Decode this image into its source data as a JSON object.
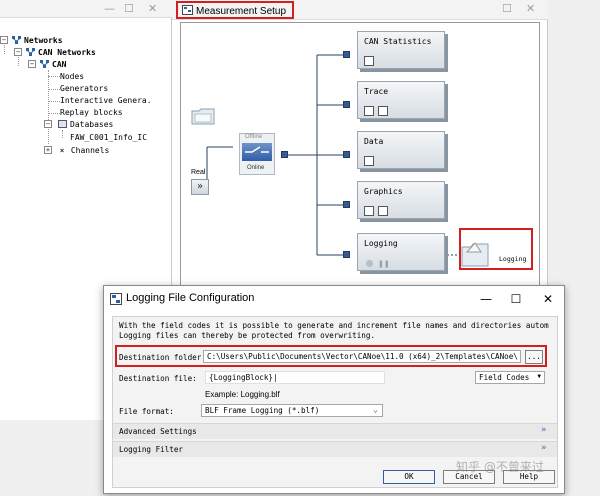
{
  "tree": {
    "items": [
      {
        "label": "Networks"
      },
      {
        "label": "CAN Networks"
      },
      {
        "label": "CAN"
      },
      {
        "label": "Nodes"
      },
      {
        "label": "Generators"
      },
      {
        "label": "Interactive Genera."
      },
      {
        "label": "Replay blocks"
      },
      {
        "label": "Databases"
      },
      {
        "label": "FAW_C001_Info_IC"
      },
      {
        "label": "Channels"
      }
    ]
  },
  "measurement_setup": {
    "title": "Measurement Setup",
    "offline_label": "Offline",
    "online_label": "Online",
    "real_label": "Real",
    "real_symbol": "»",
    "blocks": [
      {
        "label": "CAN Statistics"
      },
      {
        "label": "Trace"
      },
      {
        "label": "Data"
      },
      {
        "label": "Graphics"
      },
      {
        "label": "Logging"
      }
    ],
    "logging_node_label": "Logging"
  },
  "dialog": {
    "title": "Logging File Configuration",
    "description_line1": "With the field codes it is possible to generate and increment file names and directories autom",
    "description_line2": "Logging files can thereby be protected from overwriting.",
    "destination_folder_label": "Destination folder",
    "destination_folder_value": "C:\\Users\\Public\\Documents\\Vector\\CANoe\\11.0 (x64)_2\\Templates\\CANoe\\",
    "browse_label": "...",
    "destination_file_label": "Destination file:",
    "destination_file_value": "{LoggingBlock}|",
    "field_codes_label": "Field Codes",
    "example_text": "Example: Logging.blf",
    "file_format_label": "File format:",
    "file_format_value": "BLF Frame Logging (*.blf)",
    "advanced_settings_label": "Advanced Settings",
    "logging_filter_label": "Logging Filter",
    "ok_label": "OK",
    "cancel_label": "Cancel",
    "help_label": "Help"
  },
  "watermark": "知乎 @不曾来过",
  "colors": {
    "highlight_red": "#d21f1f",
    "connector_blue": "#3a5a8c"
  }
}
